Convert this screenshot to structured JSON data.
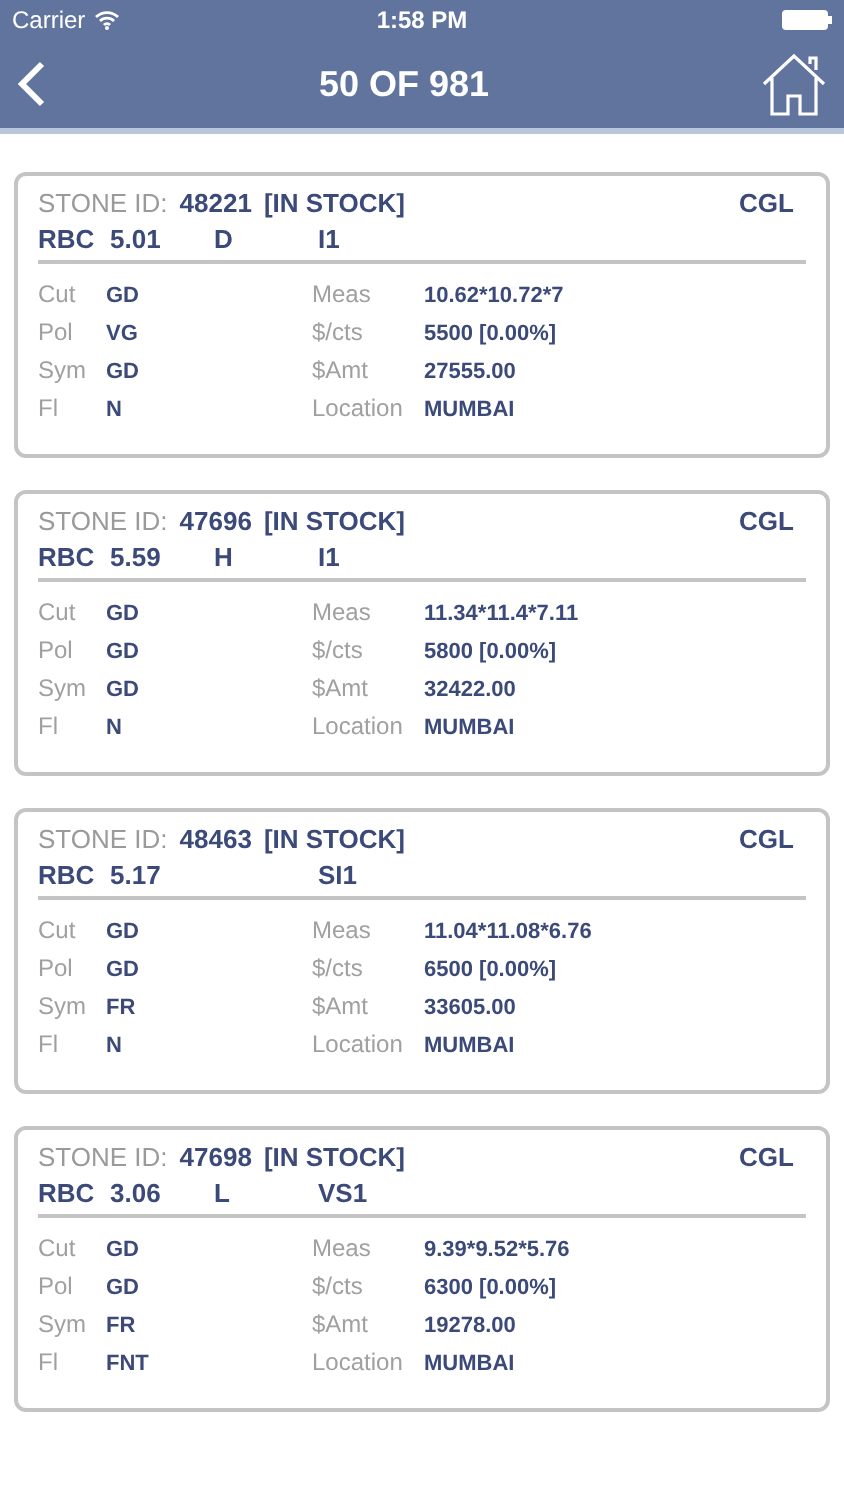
{
  "status_bar": {
    "carrier": "Carrier",
    "time": "1:58 PM"
  },
  "nav": {
    "title": "50 OF 981"
  },
  "stones": [
    {
      "id_label": "STONE ID:",
      "id": "48221",
      "stock": "[IN STOCK]",
      "lab": "CGL",
      "shape": "RBC",
      "carat": "5.01",
      "color_grade": "D",
      "clarity": "I1",
      "details": [
        {
          "label": "Cut",
          "value": "GD"
        },
        {
          "label": "Meas",
          "value": "10.62*10.72*7"
        },
        {
          "label": "Pol",
          "value": "VG"
        },
        {
          "label": "$/cts",
          "value": "5500 [0.00%]"
        },
        {
          "label": "Sym",
          "value": "GD"
        },
        {
          "label": "$Amt",
          "value": "27555.00"
        },
        {
          "label": "Fl",
          "value": "N"
        },
        {
          "label": "Location",
          "value": "MUMBAI"
        }
      ]
    },
    {
      "id_label": "STONE ID:",
      "id": "47696",
      "stock": "[IN STOCK]",
      "lab": "CGL",
      "shape": "RBC",
      "carat": "5.59",
      "color_grade": "H",
      "clarity": "I1",
      "details": [
        {
          "label": "Cut",
          "value": "GD"
        },
        {
          "label": "Meas",
          "value": "11.34*11.4*7.11"
        },
        {
          "label": "Pol",
          "value": "GD"
        },
        {
          "label": "$/cts",
          "value": "5800 [0.00%]"
        },
        {
          "label": "Sym",
          "value": "GD"
        },
        {
          "label": "$Amt",
          "value": "32422.00"
        },
        {
          "label": "Fl",
          "value": "N"
        },
        {
          "label": "Location",
          "value": "MUMBAI"
        }
      ]
    },
    {
      "id_label": "STONE ID:",
      "id": "48463",
      "stock": "[IN STOCK]",
      "lab": "CGL",
      "shape": "RBC",
      "carat": "5.17",
      "clarity": "SI1",
      "details": [
        {
          "label": "Cut",
          "value": "GD"
        },
        {
          "label": "Meas",
          "value": "11.04*11.08*6.76"
        },
        {
          "label": "Pol",
          "value": "GD"
        },
        {
          "label": "$/cts",
          "value": "6500 [0.00%]"
        },
        {
          "label": "Sym",
          "value": "FR"
        },
        {
          "label": "$Amt",
          "value": "33605.00"
        },
        {
          "label": "Fl",
          "value": "N"
        },
        {
          "label": "Location",
          "value": "MUMBAI"
        }
      ]
    },
    {
      "id_label": "STONE ID:",
      "id": "47698",
      "stock": "[IN STOCK]",
      "lab": "CGL",
      "shape": "RBC",
      "carat": "3.06",
      "color_grade": "L",
      "clarity": "VS1",
      "details": [
        {
          "label": "Cut",
          "value": "GD"
        },
        {
          "label": "Meas",
          "value": "9.39*9.52*5.76"
        },
        {
          "label": "Pol",
          "value": "GD"
        },
        {
          "label": "$/cts",
          "value": "6300 [0.00%]"
        },
        {
          "label": "Sym",
          "value": "FR"
        },
        {
          "label": "$Amt",
          "value": "19278.00"
        },
        {
          "label": "Fl",
          "value": "FNT"
        },
        {
          "label": "Location",
          "value": "MUMBAI"
        }
      ]
    }
  ]
}
